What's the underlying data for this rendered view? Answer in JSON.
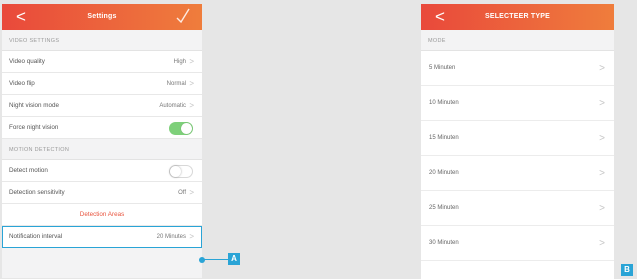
{
  "left_screen": {
    "title": "Settings",
    "back_glyph": "<",
    "video_settings_header": "VIDEO SETTINGS",
    "video_settings": [
      {
        "label": "Video quality",
        "value": "High"
      },
      {
        "label": "Video flip",
        "value": "Normal"
      },
      {
        "label": "Night vision mode",
        "value": "Automatic"
      },
      {
        "label": "Force night vision",
        "toggle": "on"
      }
    ],
    "motion_detection_header": "MOTION DETECTION",
    "motion_detection": [
      {
        "label": "Detect motion",
        "toggle": "off"
      },
      {
        "label": "Detection sensitivity",
        "value": "Off"
      }
    ],
    "detection_areas_label": "Detection Areas",
    "notification_interval": {
      "label": "Notification interval",
      "value": "20 Minutes"
    }
  },
  "right_screen": {
    "title": "SELECTEER TYPE",
    "back_glyph": "<",
    "section_header": "MODE",
    "options": [
      "5 Minuten",
      "10 Minuten",
      "15 Minuten",
      "20 Minuten",
      "25 Minuten",
      "30 Minuten"
    ]
  },
  "callouts": {
    "a": "A",
    "b": "B"
  },
  "colors": {
    "header_start": "#e9493b",
    "header_end": "#ef7d3c",
    "toggle_on": "#7ed07a",
    "callout": "#2aa4d6",
    "accent_text": "#e8553f"
  }
}
